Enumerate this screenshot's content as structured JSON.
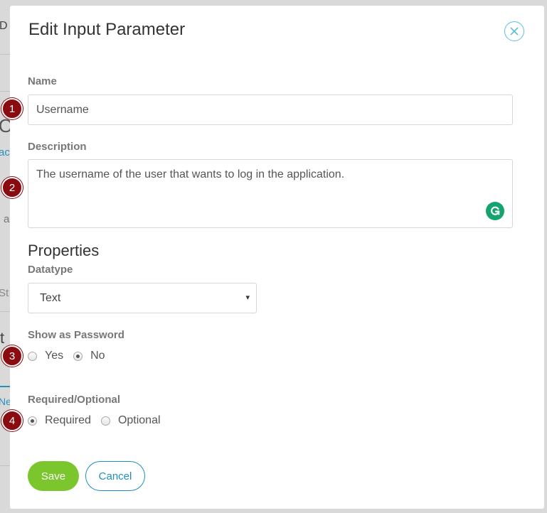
{
  "background": {
    "fragments": [
      "Op",
      "ac",
      "a",
      "St",
      "t",
      "Ne",
      "D"
    ]
  },
  "modal": {
    "title": "Edit Input Parameter",
    "close_icon": "close-icon",
    "name": {
      "label": "Name",
      "value": "Username"
    },
    "description": {
      "label": "Description",
      "value": "The username of the user that wants to log in the application.",
      "assistant_icon": "grammarly-icon"
    },
    "properties_heading": "Properties",
    "datatype": {
      "label": "Datatype",
      "selected": "Text",
      "caret": "▾"
    },
    "show_as_password": {
      "label": "Show as Password",
      "options": [
        {
          "label": "Yes",
          "checked": false
        },
        {
          "label": "No",
          "checked": true
        }
      ]
    },
    "required_optional": {
      "label": "Required/Optional",
      "options": [
        {
          "label": "Required",
          "checked": true
        },
        {
          "label": "Optional",
          "checked": false
        }
      ]
    },
    "buttons": {
      "save": "Save",
      "cancel": "Cancel"
    }
  },
  "annotations": [
    "1",
    "2",
    "3",
    "4"
  ],
  "colors": {
    "accent_green": "#7bc62d",
    "link_blue": "#1f8fc2",
    "close_blue": "#5bc0de",
    "badge_red": "#8b0c10",
    "grammarly_green": "#15a36f"
  }
}
